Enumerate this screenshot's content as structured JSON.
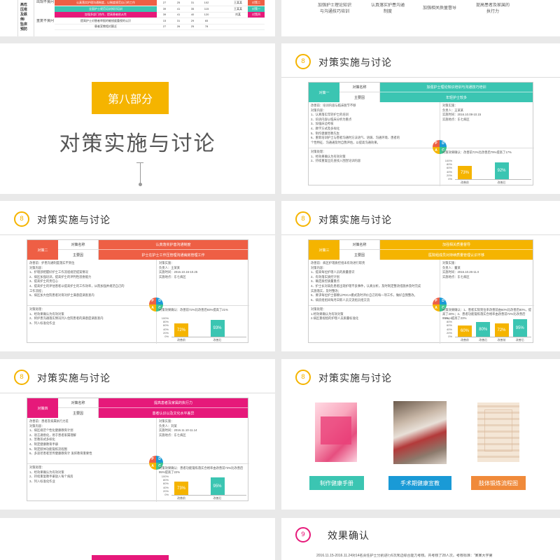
{
  "colors": {
    "yellow": "#f5b400",
    "teal": "#3bc5b2",
    "red": "#ee5f45",
    "pink": "#e6197a",
    "blue": "#1a9ad6",
    "orange": "#f08a3a",
    "green": "#3bc48e"
  },
  "top_left": {
    "side_label": "高危\n压疮\n及跌\n倒/\n坠床\n预防",
    "labels": [
      "出现不良问",
      "重复不良问"
    ],
    "rows": [
      {
        "text": "认真落实护理沟通制度，以制度规范自己的工作",
        "nums": [
          "27",
          "25",
          "31",
          "102"
        ],
        "name": "王某某",
        "tag": "对策二"
      },
      {
        "text": "全面护士规范培训知识培训",
        "nums": [
          "39",
          "41",
          "35",
          "115"
        ],
        "name": "王某某",
        "tag": "对策一"
      },
      {
        "text": "加强多部门合作，提高患者依从性",
        "nums": [
          "39",
          "41",
          "40",
          "120"
        ],
        "name": "刘某",
        "tag": "对策四"
      },
      {
        "text": "提高护士对患者举报的敏锐度重视的认识",
        "nums": [
          "15",
          "31",
          "29",
          "65"
        ],
        "name": "",
        "tag": ""
      },
      {
        "text": "患者宣教相对匮乏",
        "nums": [
          "27",
          "26",
          "25",
          "78"
        ],
        "name": "",
        "tag": ""
      }
    ]
  },
  "top_right": {
    "items": [
      "加强护士理论知识\n与沟通技巧培训",
      "认真落实护患沟通\n制度",
      "加强相关质量督导",
      "提高患者及家属的\n执行力"
    ]
  },
  "section": {
    "label": "第八部分",
    "title": "对策实施与讨论"
  },
  "slide_title": "对策实施与讨论",
  "slide_num": "8",
  "common": {
    "plan_name": "对策名称",
    "root_cause": "主要因",
    "before": "改善前",
    "after": "改善后",
    "axis": [
      "100%",
      "80%",
      "60%",
      "40%",
      "20%",
      "0%"
    ],
    "pdca": [
      "P",
      "D",
      "A",
      "C"
    ]
  },
  "c1": {
    "id": "对策一",
    "name": "加强护士理论知识培训与沟通技巧培训",
    "cause": "年轻护士较多",
    "plan": [
      "改善前：培训内容与临床脱节不够",
      "对策内容：",
      "1、认真落实年轻护士的培训",
      "2、培训内容以临床分析为重点",
      "3、加强床边考核",
      "4、教学方式及多样化",
      "5、制作健康宣教先生",
      "6、重新培训护士与患者沟通时方法语气、语调、沟通环境、患者的",
      "个性特征、沟通通及时自我评估，以提高沟通效果。"
    ],
    "owner": [
      "对策实施：",
      "负责人：王某某",
      "实施时间：2016.10.08-10.15",
      "实施地点：东七病区"
    ],
    "check": [
      "对策处理：",
      "1、经效果确认为有效对策",
      "2、持续重复出先查找入围宣培训内容"
    ],
    "confirm": "对策效果确认：改善前72%比改善后79%提高了17%",
    "values": [
      73,
      92
    ],
    "labels": [
      "73%",
      "92%"
    ]
  },
  "c2": {
    "id": "对策二",
    "name": "认真落实护患沟通制度",
    "cause": "护士在护士工作压管理沟通病房管理工作",
    "plan": [
      "改善前：护患沟通制度落实不到位",
      "对策内容：",
      "1、护理部把握好护士工作流程规范提案情况",
      "2、病区加强培训，提高护士的评判性思维能力",
      "3、提高护士的责任心",
      "4、提高护士的评估患者以提高护士的工作效率，从而加强并规范自己的",
      "工作流程；",
      "5、病区加大住院患者对育对护士满意度调查查内"
    ],
    "owner": [
      "对策实施：",
      "负责人：王某某",
      "实施时间：2016.10.16-10.25",
      "实施地点：东七病区"
    ],
    "check": [
      "对策处理：",
      "1、经效果确认为有效对策",
      "2、将护患沟通落实情况列入住院患者的满意度调查查内",
      "3、列入标准化作业"
    ],
    "confirm": "对策效果确认：改善前72%比改善后93%提高了21%",
    "values": [
      72,
      93
    ],
    "labels": [
      "72%",
      "93%"
    ]
  },
  "c3": {
    "id": "对策三",
    "name": "加强相关质量督导",
    "cause": "医院组成员对持续质量管理认识不够",
    "plan": [
      "改善前：病区护理质控组未有效进行职责",
      "对策内容：",
      "1、提高每位护理人员的质量意识",
      "2、有效落实质控计划",
      "3、确定质控质量重点",
      "4、护士长对高危患者出现护理不良事件，认真分析，及时制定整改措施并及时完成",
      "实施落实，及时整改；",
      "5、要求每位护士都要以PDCA模式及时评价自己的每一项工作，做好自我整改。",
      "6、病房组组间每月日新人员交流组员组交流"
    ],
    "owner": [
      "对策实施：",
      "负责人：董某",
      "实施时间：2016.10.26-11.9",
      "实施地点：东七病区"
    ],
    "check": [
      "对策处理：",
      "1.经效果确认为有效对策",
      "2.病区重视组的护理人员质量标准化"
    ],
    "confirm": "对策效果确认：1、患者实际到位率改善前由60%比改善后80%，提高了20%；2、患者功能锻炼落实合格率由改善前72%比改善后95%，提高了23%",
    "values": [
      60,
      80,
      72,
      95
    ],
    "labels": [
      "60%",
      "80%",
      "72%",
      "95%"
    ]
  },
  "c4": {
    "id": "对策四",
    "name": "提高患者及家属的执行力",
    "cause": "患者认识以及文化水平差异",
    "plan": [
      "改善前：患者及家属执行力差",
      "对策内容：",
      "1、病区规范个性化健康教育计划",
      "2、语言通俗化，易于患者家属理解",
      "3、宣教形式多样化",
      "4、制定健康教育手册",
      "5、制定肢体功能锻炼流程图",
      "6、多途径患者宣传健康教育计 发挥教育重要性"
    ],
    "owner": [
      "对策实施：",
      "负责人：刘某",
      "实施时间：2016.11.10-11.14",
      "实施地点：东七病区"
    ],
    "check": [
      "对策处理：",
      "1、经效果确认为有效对策",
      "2、持续重复教手册放入每个病房",
      "3、列入标准化作业"
    ],
    "confirm": "对策效果确认：患者功能锻炼落实合格率由改善前73%比改善后95%提高了22%",
    "values": [
      73,
      95
    ],
    "labels": [
      "73%",
      "95%"
    ]
  },
  "photos": {
    "items": [
      "制作健康手册",
      "手术期健康宣教",
      "肢体锻炼流程图"
    ]
  },
  "effect": {
    "num": "9",
    "title": "效果确认",
    "text": "2016.11.15-2016.11.24对14名责任护士分别进行6次床边综合能力考核。共考核了28人次。考核标准：“某某大学第"
  }
}
